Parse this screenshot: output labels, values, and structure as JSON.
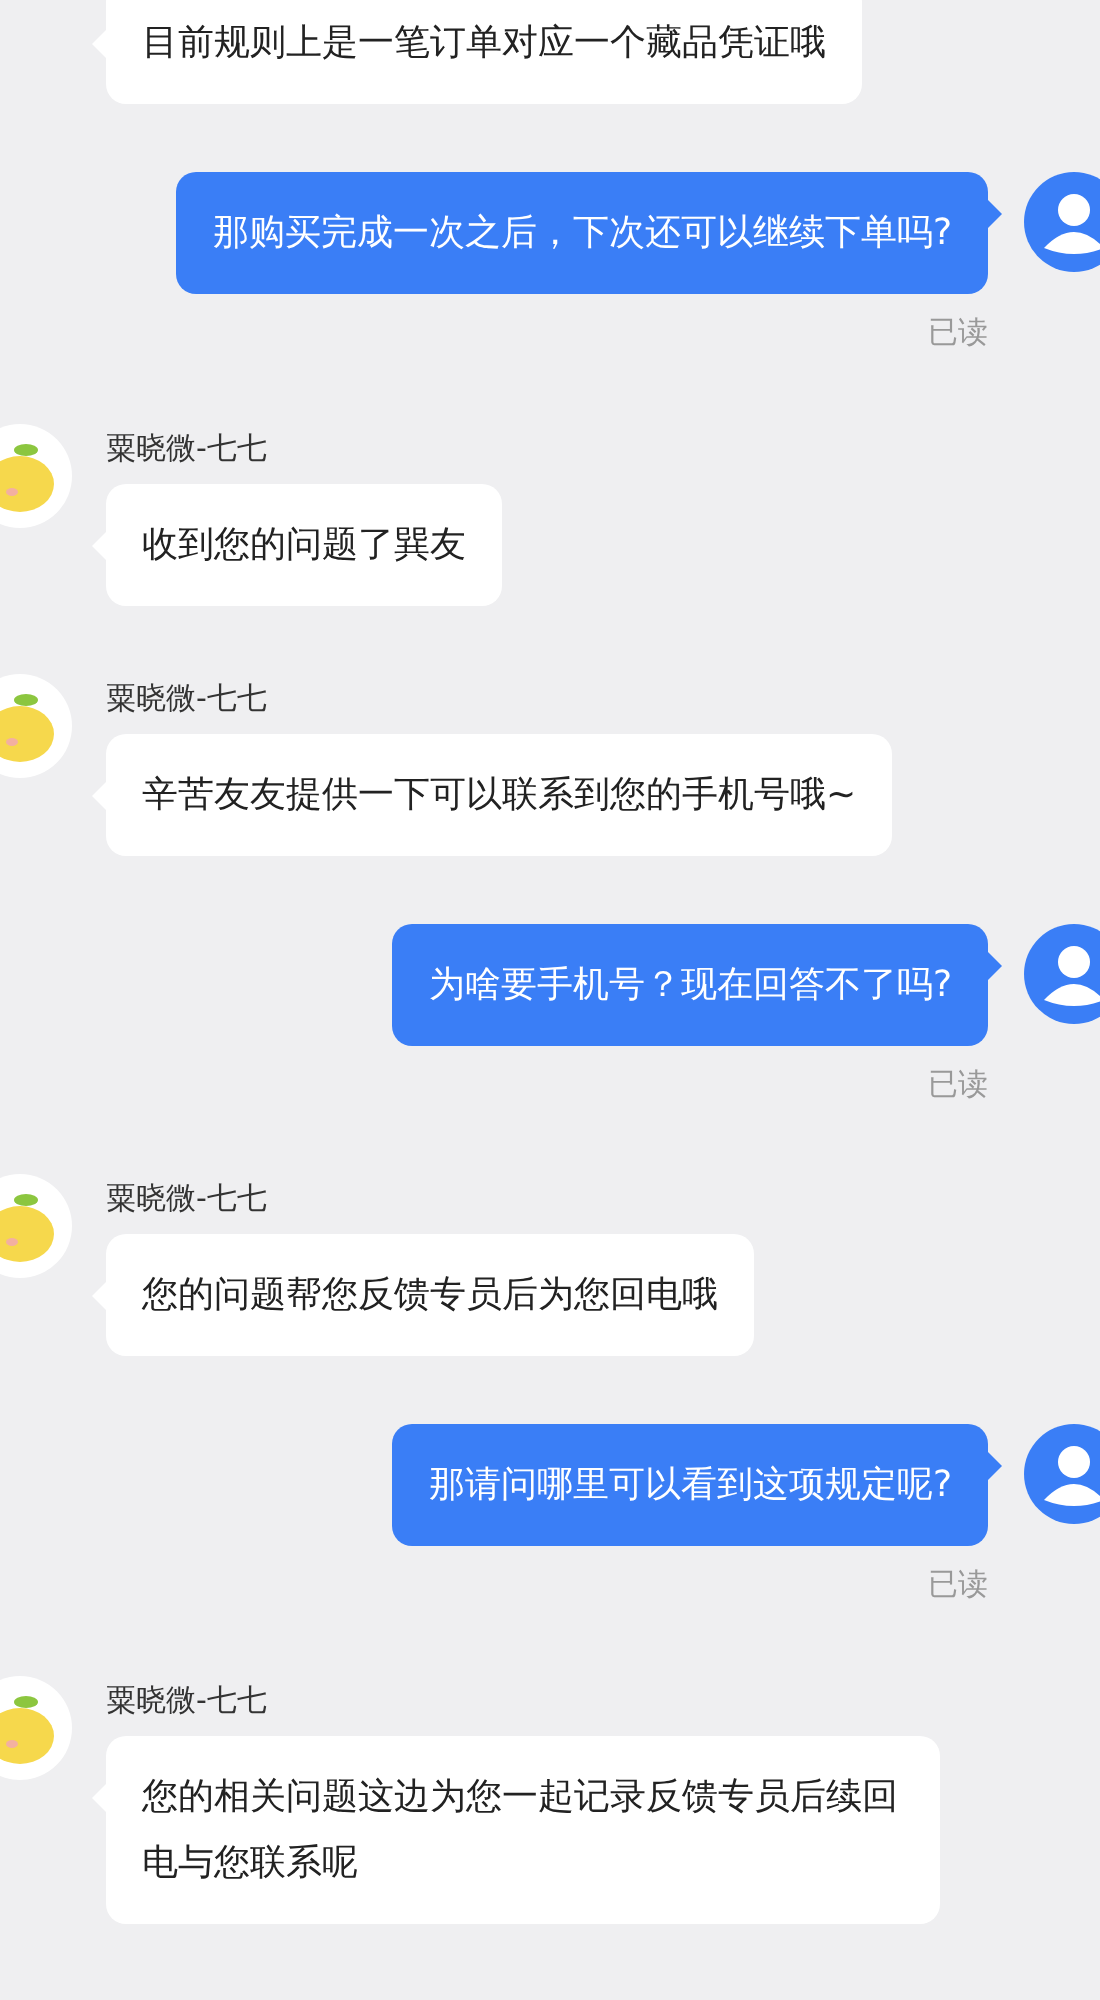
{
  "messages": [
    {
      "kind": "incoming",
      "text": "目前规则上是一笔订单对应一个藏品凭证哦"
    },
    {
      "kind": "outgoing",
      "text": "那购买完成一次之后，下次还可以继续下单吗?",
      "status": "已读"
    },
    {
      "kind": "incoming",
      "sender": "粟晓微-七七",
      "text": "收到您的问题了巽友"
    },
    {
      "kind": "incoming",
      "sender": "粟晓微-七七",
      "text": "辛苦友友提供一下可以联系到您的手机号哦~"
    },
    {
      "kind": "outgoing",
      "text": "为啥要手机号？现在回答不了吗?",
      "status": "已读"
    },
    {
      "kind": "incoming",
      "sender": "粟晓微-七七",
      "text": "您的问题帮您反馈专员后为您回电哦"
    },
    {
      "kind": "outgoing",
      "text": "那请问哪里可以看到这项规定呢?",
      "status": "已读"
    },
    {
      "kind": "incoming",
      "sender": "粟晓微-七七",
      "text": "您的相关问题这边为您一起记录反馈专员后续回电与您联系呢"
    }
  ]
}
